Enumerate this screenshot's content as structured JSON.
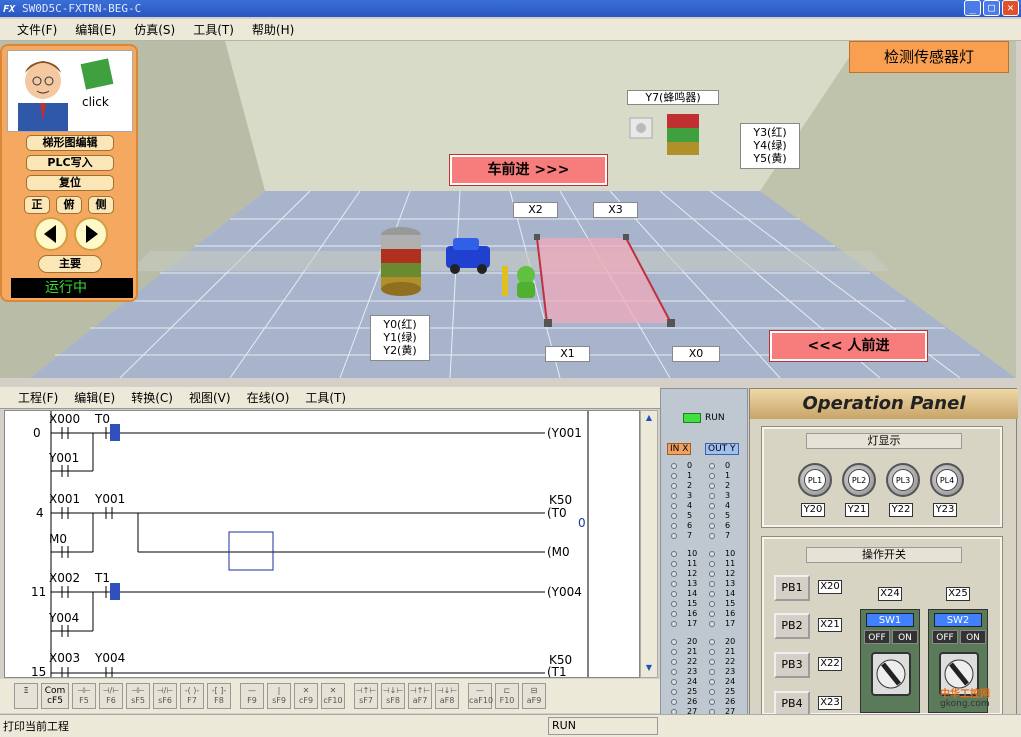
{
  "window": {
    "title": "SW0D5C-FXTRN-BEG-C",
    "logo": "FX"
  },
  "menu": [
    "文件(F)",
    "编辑(E)",
    "仿真(S)",
    "工具(T)",
    "帮助(H)"
  ],
  "sidebar": {
    "click_label": "click",
    "buttons": [
      "梯形图编辑",
      "PLC写入",
      "复位"
    ],
    "views": [
      "正",
      "俯",
      "侧"
    ],
    "main": "主要",
    "status": "运行中"
  },
  "scene": {
    "sensor_light": "检测传感器灯",
    "car_forward": "车前进 >>>",
    "person_forward": "<<< 人前进",
    "buzzer": "Y7(蜂鸣器)",
    "right_lamp": [
      "Y3(红)",
      "Y4(绿)",
      "Y5(黄)"
    ],
    "left_lamp": [
      "Y0(红)",
      "Y1(绿)",
      "Y2(黄)"
    ],
    "sensors": [
      "X2",
      "X3",
      "X1",
      "X0"
    ]
  },
  "lower_menu": [
    "工程(F)",
    "编辑(E)",
    "转换(C)",
    "视图(V)",
    "在线(O)",
    "工具(T)"
  ],
  "ladder": {
    "rungs": [
      {
        "step": "0",
        "contacts": [
          "X000",
          "T0"
        ],
        "branch": "Y001",
        "coil": "(Y001"
      },
      {
        "step": "4",
        "contacts": [
          "X001",
          "Y001"
        ],
        "branch": "M0",
        "coil": "(T0",
        "coil_arg": "K50",
        "coil2": "(M0",
        "value": "0"
      },
      {
        "step": "11",
        "contacts": [
          "X002",
          "T1"
        ],
        "branch": "Y004",
        "coil": "(Y004"
      },
      {
        "step": "15",
        "contacts": [
          "X003",
          "Y004"
        ],
        "coil": "(T1",
        "coil_arg": "K50"
      }
    ]
  },
  "toolbar": [
    {
      "top": "Com",
      "bottom": "cF5"
    },
    {
      "top": "",
      "bottom": "F5"
    },
    {
      "top": "",
      "bottom": "F6"
    },
    {
      "top": "",
      "bottom": "sF5"
    },
    {
      "top": "",
      "bottom": "sF6"
    },
    {
      "top": "",
      "bottom": "F7"
    },
    {
      "top": "",
      "bottom": "F8"
    },
    {
      "top": "",
      "bottom": "F9"
    },
    {
      "top": "",
      "bottom": "sF9"
    },
    {
      "top": "",
      "bottom": "cF9"
    },
    {
      "top": "",
      "bottom": "cF10"
    },
    {
      "top": "",
      "bottom": "sF7"
    },
    {
      "top": "",
      "bottom": "sF8"
    },
    {
      "top": "",
      "bottom": "aF7"
    },
    {
      "top": "",
      "bottom": "aF8"
    },
    {
      "top": "",
      "bottom": "caF10"
    },
    {
      "top": "",
      "bottom": "F10"
    },
    {
      "top": "",
      "bottom": "aF9"
    }
  ],
  "status_bar": {
    "left": "打印当前工程",
    "mode": "RUN"
  },
  "io_panel": {
    "run": "RUN",
    "in_header": "IN X",
    "out_header": "OUT Y",
    "group1": [
      "0",
      "1",
      "2",
      "3",
      "4",
      "5",
      "6",
      "7"
    ],
    "group2": [
      "10",
      "11",
      "12",
      "13",
      "14",
      "15",
      "16",
      "17"
    ],
    "group3": [
      "20",
      "21",
      "22",
      "23",
      "24",
      "25",
      "26",
      "27"
    ]
  },
  "operation_panel": {
    "title": "Operation Panel",
    "lamp_section": "灯显示",
    "lamps": [
      {
        "label": "PL1",
        "tag": "Y20"
      },
      {
        "label": "PL2",
        "tag": "Y21"
      },
      {
        "label": "PL3",
        "tag": "Y22"
      },
      {
        "label": "PL4",
        "tag": "Y23"
      }
    ],
    "switch_section": "操作开关",
    "push_buttons": [
      {
        "label": "PB1",
        "tag": "X20"
      },
      {
        "label": "PB2",
        "tag": "X21"
      },
      {
        "label": "PB3",
        "tag": "X22"
      },
      {
        "label": "PB4",
        "tag": "X23"
      }
    ],
    "switches": [
      {
        "label": "SW1",
        "tag": "X24",
        "off": "OFF",
        "on": "ON"
      },
      {
        "label": "SW2",
        "tag": "X25",
        "off": "OFF",
        "on": "ON"
      }
    ]
  },
  "watermark": {
    "site": "中华工控网",
    "url": "gkong.com"
  }
}
